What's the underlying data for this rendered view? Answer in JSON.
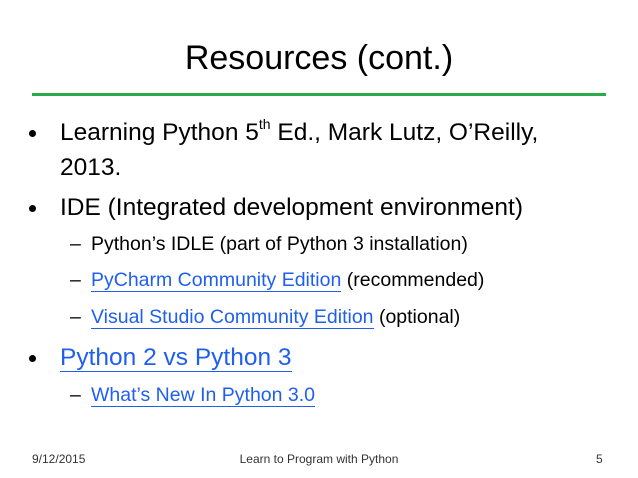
{
  "slide": {
    "title": "Resources (cont.)",
    "accent_color": "#2bab4a",
    "link_color": "#1f5ff0",
    "bullets": {
      "b1_main": "Learning Python 5",
      "b1_sup": "th",
      "b1_rest": " Ed., Mark Lutz, O’Reilly,",
      "b1_cont": "2013.",
      "b2": "IDE (Integrated development environment)",
      "b2_sub1": "Python’s IDLE (part of Python 3 installation)",
      "b2_sub2_link": "PyCharm Community Edition",
      "b2_sub2_rest": " (recommended)",
      "b2_sub3_link": "Visual Studio Community Edition",
      "b2_sub3_rest": " (optional)",
      "b3_link": "Python 2 vs Python 3",
      "b3_sub1_link": "What’s New In Python 3.0"
    },
    "dash": "–",
    "footer": {
      "date": "9/12/2015",
      "center": "Learn to Program with Python",
      "page": "5"
    }
  }
}
